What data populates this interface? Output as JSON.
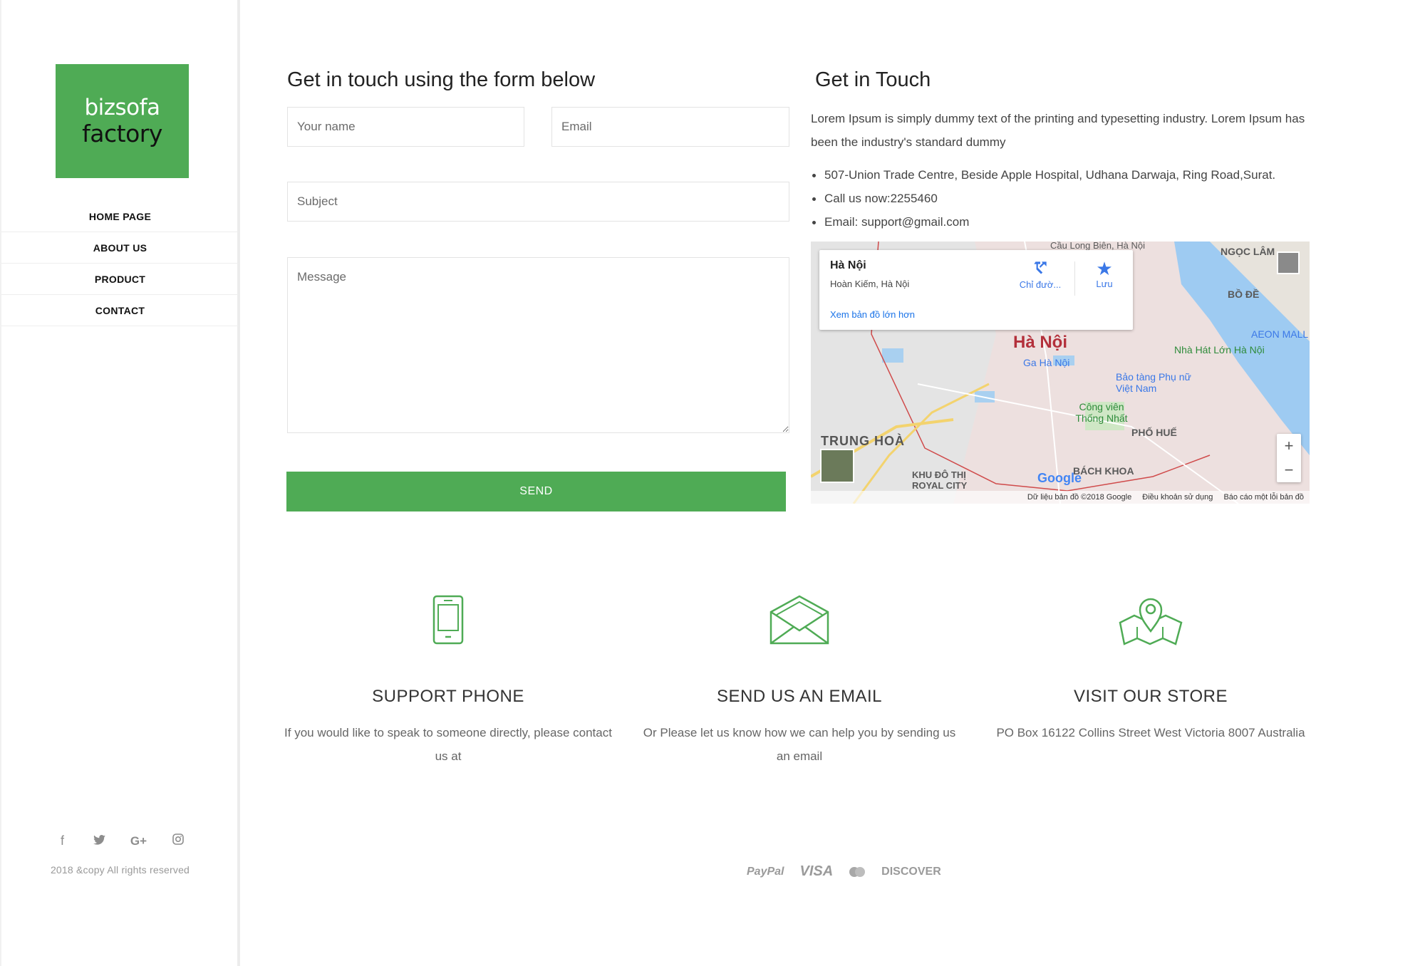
{
  "brand": {
    "logo_line1": "bizsofa",
    "logo_line2": "factory",
    "color": "#4fab55"
  },
  "nav": {
    "items": [
      {
        "label": "HOME PAGE"
      },
      {
        "label": "ABOUT US"
      },
      {
        "label": "PRODUCT"
      },
      {
        "label": "CONTACT"
      }
    ]
  },
  "social": {
    "icons": [
      "facebook-icon",
      "twitter-icon",
      "google-plus-icon",
      "instagram-icon"
    ]
  },
  "footer": {
    "copyright": "2018 &copy All rights reserved"
  },
  "form": {
    "title": "Get in touch using the form below",
    "name_placeholder": "Your name",
    "email_placeholder": "Email",
    "subject_placeholder": "Subject",
    "message_placeholder": "Message",
    "send_label": "SEND"
  },
  "info": {
    "title": "Get in Touch",
    "intro": "Lorem Ipsum is simply dummy text of the printing and typesetting industry. Lorem Ipsum has been the industry's standard dummy",
    "items": [
      "507-Union Trade Centre, Beside Apple Hospital, Udhana Darwaja, Ring Road,Surat.",
      "Call us now:2255460",
      "Email: support@gmail.com"
    ]
  },
  "map": {
    "place": "Hà Nội",
    "address": "Hoàn Kiếm, Hà Nội",
    "directions": "Chỉ đườ...",
    "save": "Lưu",
    "view_larger": "Xem bản đồ lớn hơn",
    "labels": {
      "city": "Hà Nội",
      "station": "Ga Hà Nội",
      "trung_hoa": "TRUNG HOÀ",
      "bach_khoa": "BÁCH KHOA",
      "pho_hue": "PHỐ HUẾ",
      "ngoc_lam": "NGỌC LÂM",
      "bo_de": "BỒ ĐỀ",
      "park": "Công viên Thống Nhất",
      "museum": "Bảo tàng Phụ nữ Việt Nam",
      "opera": "Nhà Hát Lớn Hà Nội",
      "aeon": "AEON MALL",
      "royal_city": "KHU ĐÔ THỊ ROYAL CITY",
      "bridge": "Cầu Long Biên, Hà Nội"
    },
    "attribution": [
      "Dữ liệu bản đồ ©2018 Google",
      "Điều khoản sử dụng",
      "Báo cáo một lỗi bản đồ"
    ],
    "google": "Google"
  },
  "features": [
    {
      "icon": "phone-icon",
      "title": "SUPPORT PHONE",
      "text": "If you would like to speak to someone directly, please contact us at"
    },
    {
      "icon": "envelope-icon",
      "title": "SEND US AN EMAIL",
      "text": "Or Please let us know how we can help you by sending us an email"
    },
    {
      "icon": "map-pin-icon",
      "title": "VISIT OUR STORE",
      "text": "PO Box 16122 Collins Street West Victoria 8007 Australia"
    }
  ],
  "payments": [
    "PayPal",
    "VISA",
    "mastercard-icon",
    "DISCOVER"
  ]
}
